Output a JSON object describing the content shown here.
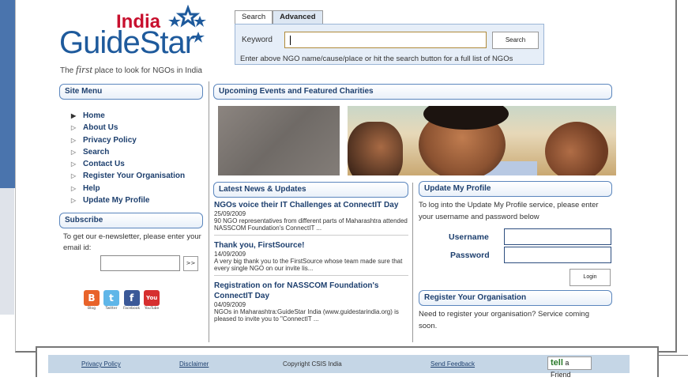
{
  "logo": {
    "india": "India",
    "guidestar": "GuideStar",
    "tagline_prefix": "The ",
    "tagline_first": "first",
    "tagline_rest": " place to look for NGOs in India"
  },
  "search": {
    "tabs": [
      "Search",
      "Advanced"
    ],
    "keyword_label": "Keyword",
    "keyword_value": "",
    "button_label": "Search",
    "help_text": "Enter above NGO name/cause/place or hit the search button for a full list of NGOs"
  },
  "site_menu": {
    "title": "Site Menu",
    "items": [
      "Home",
      "About Us",
      "Privacy Policy",
      "Search",
      "Contact Us",
      "Register Your Organisation",
      "Help",
      "Update My Profile"
    ]
  },
  "subscribe": {
    "title": "Subscribe",
    "text": "To get our e-newsletter, please enter your email id:",
    "go_label": ">>",
    "email_value": ""
  },
  "social": [
    {
      "name": "Blog",
      "icon": "B",
      "color": "#e8632a"
    },
    {
      "name": "Twitter",
      "icon": "t",
      "color": "#5fb6e8"
    },
    {
      "name": "Facebook",
      "icon": "f",
      "color": "#3b5998"
    },
    {
      "name": "YouTube",
      "icon": "You",
      "color": "#d62f2f"
    }
  ],
  "events": {
    "title": "Upcoming Events and Featured Charities"
  },
  "news": {
    "title": "Latest News & Updates",
    "items": [
      {
        "title": "NGOs voice their IT Challenges at ConnectIT Day",
        "date": "25/09/2009",
        "body": "90 NGO representatives from different parts of Maharashtra attended NASSCOM Foundation's ConnectIT ..."
      },
      {
        "title": "Thank you, FirstSource!",
        "date": "14/09/2009",
        "body": "A very big thank you to the FirstSource whose team made sure that every single NGO on our invite lis..."
      },
      {
        "title": "Registration on for NASSCOM Foundation's ConnectIT Day",
        "date": "04/09/2009",
        "body": "NGOs in Maharashtra:GuideStar India (www.guidestarindia.org) is pleased to invite you to \"ConnectIT ..."
      }
    ]
  },
  "update_profile": {
    "title": "Update My Profile",
    "text": "To log into the Update My Profile service, please enter your username and password below",
    "username_label": "Username",
    "password_label": "Password",
    "login_label": "Login"
  },
  "register": {
    "title": "Register Your Organisation",
    "text": "Need to register your organisation? Service coming soon."
  },
  "footer": {
    "privacy": "Privacy Policy",
    "disclaimer": "Disclaimer",
    "copyright": "Copyright CSIS India",
    "feedback": "Send Feedback",
    "tell_a_friend": "a Friend",
    "tell_prefix": "tell"
  }
}
